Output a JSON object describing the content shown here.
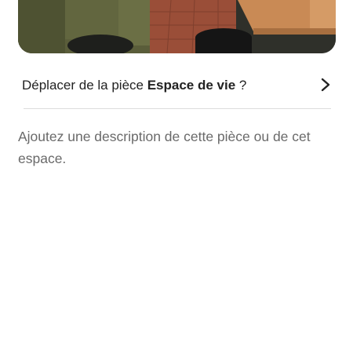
{
  "photo": {
    "icon": "living-room-photo"
  },
  "move_row": {
    "prefix": "Déplacer de la pièce ",
    "room": "Espace de vie",
    "suffix": " ?",
    "chevron_icon": "chevron-right-icon"
  },
  "description": {
    "placeholder": "Ajoutez une description de cette pièce ou de cet espace."
  },
  "colors": {
    "text_primary": "#222222",
    "text_secondary": "#6a6a6a",
    "divider": "#dddddd"
  }
}
